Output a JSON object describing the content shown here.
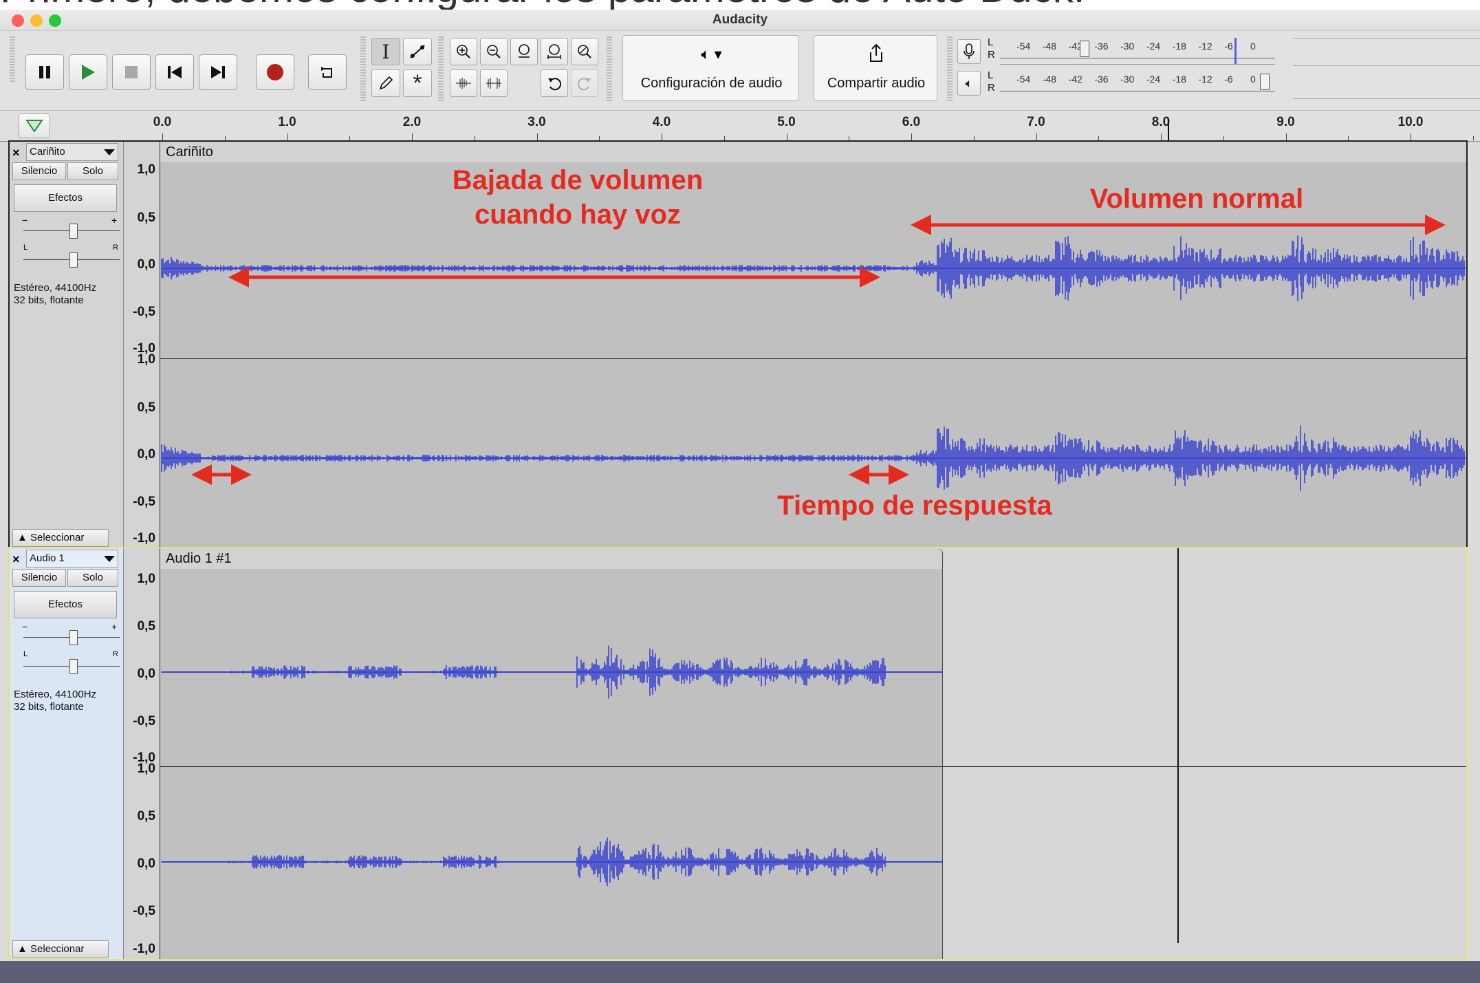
{
  "caption": "Primero, debemos configurar los parámetros de Auto Duck.",
  "window": {
    "title": "Audacity"
  },
  "toolbar": {
    "audio_setup_label": "Configuración de audio",
    "share_label": "Compartir audio",
    "meter_scale": [
      "-54",
      "-48",
      "-42",
      "-36",
      "-30",
      "-24",
      "-18",
      "-12",
      "-6",
      "0"
    ],
    "rec_meter_channels": [
      "L",
      "R"
    ],
    "play_meter_channels": [
      "L",
      "R"
    ]
  },
  "ruler": {
    "labels": [
      "0.0",
      "1.0",
      "2.0",
      "3.0",
      "4.0",
      "5.0",
      "6.0",
      "7.0",
      "8.0",
      "9.0",
      "10.0"
    ]
  },
  "tracks": [
    {
      "name": "Cariñito",
      "clip_name": "Cariñito",
      "mute": "Silencio",
      "solo": "Solo",
      "effects": "Efectos",
      "format_line1": "Estéreo, 44100Hz",
      "format_line2": "32 bits, flotante",
      "select": "Seleccionar",
      "scale": [
        "1,0",
        "0,5",
        "0,0",
        "-0,5",
        "-1,0"
      ]
    },
    {
      "name": "Audio 1",
      "clip_name": "Audio 1 #1",
      "mute": "Silencio",
      "solo": "Solo",
      "effects": "Efectos",
      "format_line1": "Estéreo, 44100Hz",
      "format_line2": "32 bits, flotante",
      "select": "Seleccionar",
      "scale": [
        "1,0",
        "0,5",
        "0,0",
        "-0,5",
        "-1,0"
      ]
    }
  ],
  "annotations": {
    "ducking_line1": "Bajada de volumen",
    "ducking_line2": "cuando hay voz",
    "normal": "Volumen normal",
    "response": "Tiempo de respuesta"
  },
  "pan_labels": {
    "left": "L",
    "right": "R",
    "minus": "−",
    "plus": "+"
  },
  "colors": {
    "waveform": "#3a43cf",
    "annotation": "#e52b20",
    "selected_track_border": "#e8e07a"
  }
}
